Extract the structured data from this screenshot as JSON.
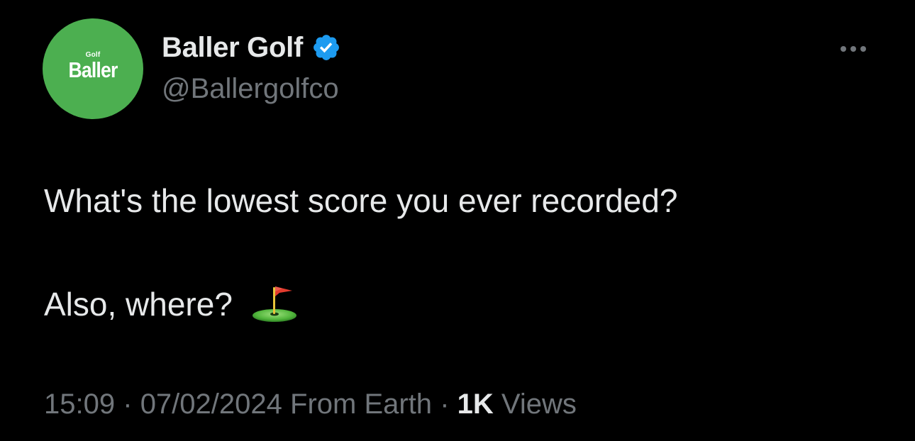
{
  "author": {
    "avatar": {
      "small_text": "Golf",
      "main_text": "Baller",
      "bg_color": "#4caf50"
    },
    "display_name": "Baller Golf",
    "handle": "@Ballergolfco",
    "verified": true,
    "verified_icon": "verified-badge-icon",
    "verified_color": "#1d9bf0"
  },
  "more_menu_icon": "more-horizontal-icon",
  "tweet": {
    "line1": "What's the lowest score you ever recorded?",
    "line2": "Also, where?",
    "emoji": "flag-in-hole-emoji"
  },
  "meta": {
    "time": "15:09",
    "separator1": "·",
    "date": "07/02/2024",
    "location": "From Earth",
    "separator2": "·",
    "views_count": "1K",
    "views_label": "Views"
  },
  "colors": {
    "background": "#000000",
    "primary_text": "#e7e9ea",
    "secondary_text": "#71767b"
  }
}
